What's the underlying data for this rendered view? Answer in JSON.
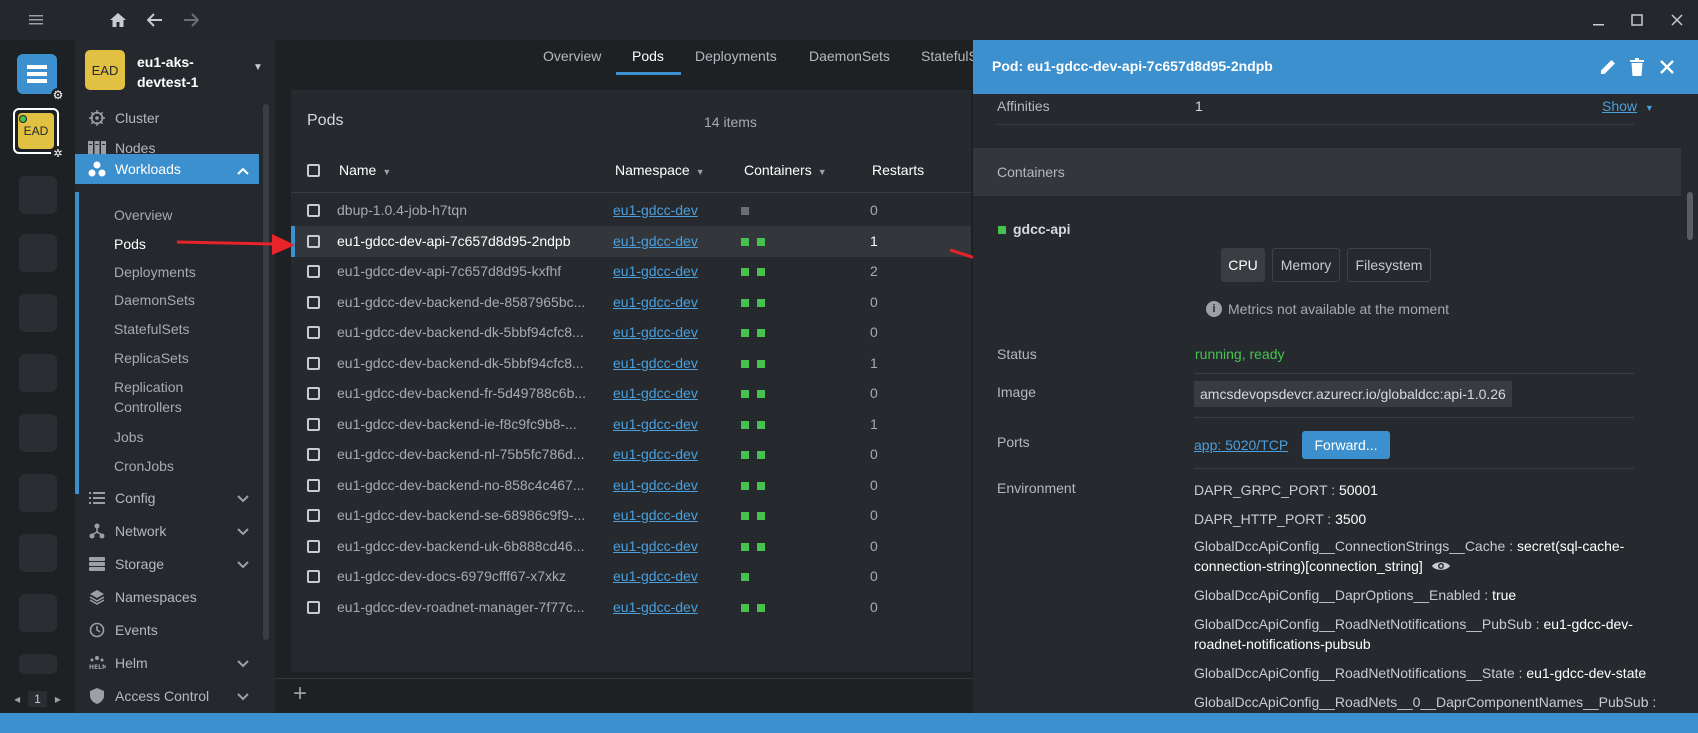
{
  "hotbar": {
    "cluster_label": "EAD",
    "page_number": "1"
  },
  "sidebar": {
    "cluster_avatar": "EAD",
    "cluster_name": "eu1-aks-devtest-1",
    "items": [
      {
        "label": "Cluster",
        "icon": "helm-wheel-icon"
      },
      {
        "label": "Nodes",
        "icon": "nodes-icon"
      },
      {
        "label": "Workloads",
        "icon": "workloads-icon"
      },
      {
        "label": "Config",
        "icon": "config-list-icon"
      },
      {
        "label": "Network",
        "icon": "network-icon"
      },
      {
        "label": "Storage",
        "icon": "storage-icon"
      },
      {
        "label": "Namespaces",
        "icon": "layers-icon"
      },
      {
        "label": "Events",
        "icon": "clock-icon"
      },
      {
        "label": "Helm",
        "icon": "helm-icon"
      },
      {
        "label": "Access Control",
        "icon": "shield-icon"
      }
    ],
    "workloads_sub": [
      "Overview",
      "Pods",
      "Deployments",
      "DaemonSets",
      "StatefulSets",
      "ReplicaSets",
      "Replication Controllers",
      "Jobs",
      "CronJobs"
    ]
  },
  "tabs": [
    "Overview",
    "Pods",
    "Deployments",
    "DaemonSets",
    "StatefulS"
  ],
  "pods": {
    "title": "Pods",
    "count": "14 items",
    "columns": {
      "name": "Name",
      "namespace": "Namespace",
      "containers": "Containers",
      "restarts": "Restarts"
    },
    "rows": [
      {
        "name": "dbup-1.0.4-job-h7tqn",
        "namespace": "eu1-gdcc-dev",
        "containers": [
          "gray"
        ],
        "restarts": "0"
      },
      {
        "name": "eu1-gdcc-dev-api-7c657d8d95-2ndpb",
        "namespace": "eu1-gdcc-dev",
        "containers": [
          "green",
          "green"
        ],
        "restarts": "1"
      },
      {
        "name": "eu1-gdcc-dev-api-7c657d8d95-kxfhf",
        "namespace": "eu1-gdcc-dev",
        "containers": [
          "green",
          "green"
        ],
        "restarts": "2"
      },
      {
        "name": "eu1-gdcc-dev-backend-de-8587965bc...",
        "namespace": "eu1-gdcc-dev",
        "containers": [
          "green",
          "green"
        ],
        "restarts": "0"
      },
      {
        "name": "eu1-gdcc-dev-backend-dk-5bbf94cfc8...",
        "namespace": "eu1-gdcc-dev",
        "containers": [
          "green",
          "green"
        ],
        "restarts": "0"
      },
      {
        "name": "eu1-gdcc-dev-backend-dk-5bbf94cfc8...",
        "namespace": "eu1-gdcc-dev",
        "containers": [
          "green",
          "green"
        ],
        "restarts": "1"
      },
      {
        "name": "eu1-gdcc-dev-backend-fr-5d49788c6b...",
        "namespace": "eu1-gdcc-dev",
        "containers": [
          "green",
          "green"
        ],
        "restarts": "0"
      },
      {
        "name": "eu1-gdcc-dev-backend-ie-f8c9fc9b8-...",
        "namespace": "eu1-gdcc-dev",
        "containers": [
          "green",
          "green"
        ],
        "restarts": "1"
      },
      {
        "name": "eu1-gdcc-dev-backend-nl-75b5fc786d...",
        "namespace": "eu1-gdcc-dev",
        "containers": [
          "green",
          "green"
        ],
        "restarts": "0"
      },
      {
        "name": "eu1-gdcc-dev-backend-no-858c4c467...",
        "namespace": "eu1-gdcc-dev",
        "containers": [
          "green",
          "green"
        ],
        "restarts": "0"
      },
      {
        "name": "eu1-gdcc-dev-backend-se-68986c9f9-...",
        "namespace": "eu1-gdcc-dev",
        "containers": [
          "green",
          "green"
        ],
        "restarts": "0"
      },
      {
        "name": "eu1-gdcc-dev-backend-uk-6b888cd46...",
        "namespace": "eu1-gdcc-dev",
        "containers": [
          "green",
          "green"
        ],
        "restarts": "0"
      },
      {
        "name": "eu1-gdcc-dev-docs-6979cfff67-x7xkz",
        "namespace": "eu1-gdcc-dev",
        "containers": [
          "green"
        ],
        "restarts": "0"
      },
      {
        "name": "eu1-gdcc-dev-roadnet-manager-7f77c...",
        "namespace": "eu1-gdcc-dev",
        "containers": [
          "green",
          "green"
        ],
        "restarts": "0"
      }
    ]
  },
  "drawer": {
    "title": "Pod: eu1-gdcc-dev-api-7c657d8d95-2ndpb",
    "affinities_label": "Affinities",
    "affinities_value": "1",
    "show_label": "Show",
    "containers_label": "Containers",
    "container_name": "gdcc-api",
    "metric_tabs": [
      "CPU",
      "Memory",
      "Filesystem"
    ],
    "metrics_note": "Metrics not available at the moment",
    "status_label": "Status",
    "status_value": "running, ready",
    "image_label": "Image",
    "image_value": "amcsdevopsdevcr.azurecr.io/globaldcc:api-1.0.26",
    "ports_label": "Ports",
    "port_link": "app: 5020/TCP",
    "forward_label": "Forward...",
    "environment_label": "Environment",
    "env": [
      {
        "key": "DAPR_GRPC_PORT",
        "value": "50001"
      },
      {
        "key": "DAPR_HTTP_PORT",
        "value": "3500"
      },
      {
        "key": "GlobalDccApiConfig__ConnectionStrings__Cache",
        "value": "secret(sql-cache-connection-string)[connection_string]"
      },
      {
        "key": "GlobalDccApiConfig__DaprOptions__Enabled",
        "value": "true"
      },
      {
        "key": "GlobalDccApiConfig__RoadNetNotifications__PubSub",
        "value": "eu1-gdcc-dev-roadnet-notifications-pubsub"
      },
      {
        "key": "GlobalDccApiConfig__RoadNetNotifications__State",
        "value": "eu1-gdcc-dev-state"
      },
      {
        "key": "GlobalDccApiConfig__RoadNets__0__DaprComponentNames__PubSub",
        "value": ""
      }
    ]
  },
  "colors": {
    "accent": "#3d90ce",
    "ok_green": "#48c24f",
    "avatar_yellow": "#e1c042",
    "arrow_red": "#e8232a"
  }
}
